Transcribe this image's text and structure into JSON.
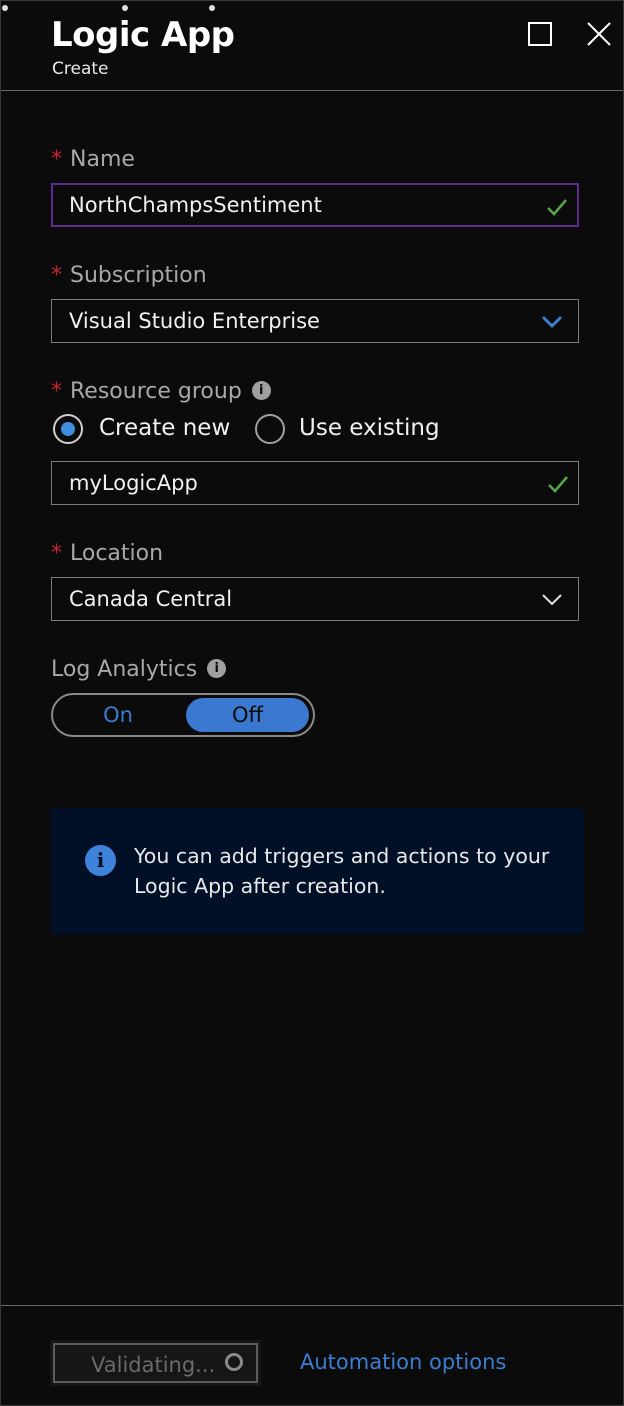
{
  "window": {
    "title": "Logic App",
    "subtitle": "Create",
    "maximize_icon": "maximize-icon",
    "close_icon": "close-icon"
  },
  "form": {
    "required_marker": "*",
    "name": {
      "label": "Name",
      "value": "NorthChampsSentiment",
      "valid": true
    },
    "subscription": {
      "label": "Subscription",
      "value": "Visual Studio Enterprise"
    },
    "resource_group": {
      "label": "Resource group",
      "info_icon": "info-icon",
      "options": [
        "Create new",
        "Use existing"
      ],
      "selected": "Create new",
      "value": "myLogicApp",
      "valid": true
    },
    "location": {
      "label": "Location",
      "value": "Canada Central"
    },
    "log_analytics": {
      "label": "Log Analytics",
      "info_icon": "info-icon",
      "on_label": "On",
      "off_label": "Off",
      "selected": "Off"
    }
  },
  "infobox": {
    "icon": "info-icon",
    "text": "You can add triggers and actions to your Logic App after creation."
  },
  "footer": {
    "validate_label": "Validating...",
    "automation_label": "Automation options"
  },
  "colors": {
    "background": "#0b0b0b",
    "accent_blue": "#3b7dd0",
    "required_red": "#c4262e",
    "valid_green": "#57a64a",
    "focus_purple": "#5c2d91",
    "infobox_bg": "#021027"
  }
}
